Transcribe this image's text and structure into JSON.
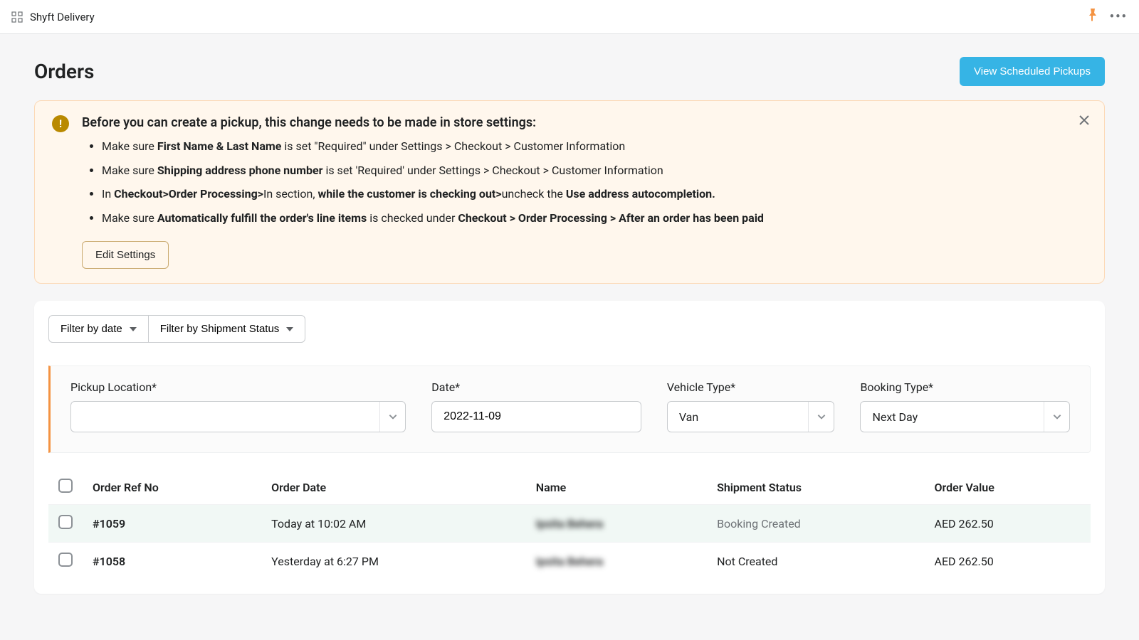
{
  "app": {
    "name": "Shyft Delivery"
  },
  "page": {
    "title": "Orders"
  },
  "header": {
    "view_pickups": "View Scheduled Pickups"
  },
  "alert": {
    "heading": "Before you can create a pickup, this change needs to be made in store settings:",
    "items": [
      "Make sure <b>First Name & Last Name</b> is set \"Required\" under Settings > Checkout > Customer Information",
      "Make sure <b>Shipping address phone number</b> is set 'Required' under Settings > Checkout > Customer Information",
      "In <b>Checkout>Order Processing></b>In section, <b>while the customer is checking out></b>uncheck the <b>Use address autocompletion.</b>",
      "Make sure <b>Automatically fulfill the order's line items</b> is checked under <b>Checkout > Order Processing > After an order has been paid</b>"
    ],
    "edit_settings": "Edit Settings"
  },
  "filters": {
    "by_date": "Filter by date",
    "by_status": "Filter by Shipment Status"
  },
  "form": {
    "pickup_location": {
      "label": "Pickup Location*",
      "value": ""
    },
    "date": {
      "label": "Date*",
      "value": "2022-11-09"
    },
    "vehicle_type": {
      "label": "Vehicle Type*",
      "value": "Van"
    },
    "booking_type": {
      "label": "Booking Type*",
      "value": "Next Day"
    }
  },
  "table": {
    "headers": {
      "ref": "Order Ref No",
      "date": "Order Date",
      "name": "Name",
      "status": "Shipment Status",
      "value": "Order Value"
    },
    "rows": [
      {
        "ref": "#1059",
        "date": "Today at 10:02 AM",
        "name": "Ipsita Behera",
        "status": "Booking Created",
        "status_muted": true,
        "value": "AED 262.50"
      },
      {
        "ref": "#1058",
        "date": "Yesterday at 6:27 PM",
        "name": "Ipsita Behera",
        "status": "Not Created",
        "status_muted": false,
        "value": "AED 262.50"
      }
    ]
  }
}
